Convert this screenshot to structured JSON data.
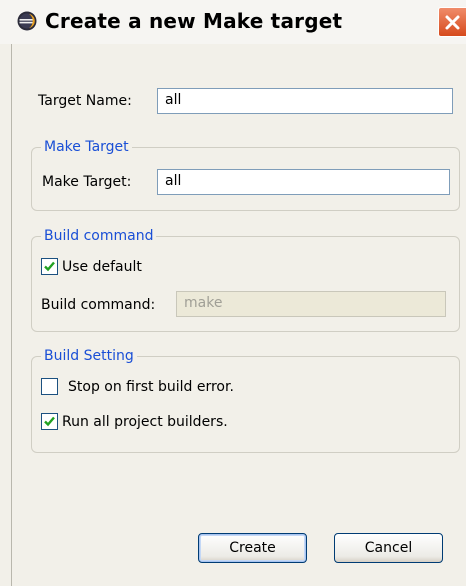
{
  "window": {
    "title": "Create a new Make target"
  },
  "target_name": {
    "label": "Target Name:",
    "value": "all"
  },
  "make_target_group": {
    "title": "Make Target",
    "label": "Make Target:",
    "value": "all"
  },
  "build_command_group": {
    "title": "Build command",
    "use_default_label": "Use default",
    "use_default_checked": true,
    "command_label": "Build command:",
    "command_value": "make",
    "command_enabled": false
  },
  "build_setting_group": {
    "title": "Build Setting",
    "stop_on_error_label": "Stop on first build error.",
    "stop_on_error_checked": false,
    "run_all_builders_label": "Run all project builders.",
    "run_all_builders_checked": true
  },
  "buttons": {
    "create_label": "Create",
    "cancel_label": "Cancel"
  },
  "colors": {
    "group_title": "#1a4fd6",
    "checkmark": "#21a121",
    "close_button": "#d64a1c"
  },
  "icons": {
    "app": "eclipse-icon",
    "close": "close-icon",
    "check": "checkmark-icon"
  }
}
